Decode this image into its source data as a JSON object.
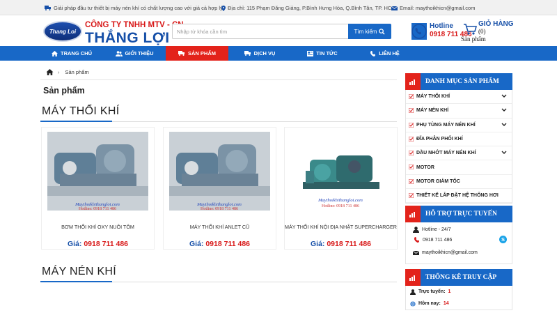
{
  "topbar": {
    "slogan": "Giải pháp đầu tư thiết bị máy nén khí có chất lượng cao với giá cả hợp lý",
    "address": "Địa chỉ: 115 Phạm Đăng Giảng, P.Bình Hưng Hòa, Q.Bình Tân, TP. HCM",
    "email": "Email: maythoikhicn@gmail.com"
  },
  "logo": {
    "badge": "Thang Loi",
    "company_line1": "CÔNG TY TNHH MTV - CN",
    "company_line2": "THẮNG LỢI"
  },
  "search": {
    "placeholder": "Nhập từ khóa cần tìm",
    "button": "Tìm kiếm"
  },
  "hotline": {
    "label": "Hotline",
    "number": "0918 711 486"
  },
  "cart": {
    "label": "GIỎ HÀNG",
    "count": "(0)",
    "unit": "Sản phẩm"
  },
  "nav": {
    "items": [
      {
        "label": "TRANG CHỦ",
        "icon": "home-icon"
      },
      {
        "label": "GIỚI THIỆU",
        "icon": "users-icon"
      },
      {
        "label": "SẢN PHẨM",
        "icon": "truck-icon",
        "active": true
      },
      {
        "label": "DỊCH VỤ",
        "icon": "truck-icon"
      },
      {
        "label": "TIN TỨC",
        "icon": "news-icon"
      },
      {
        "label": "LIÊN HỆ",
        "icon": "phone-icon"
      }
    ]
  },
  "breadcrumb": {
    "current": "Sản phẩm"
  },
  "page_title": "Sản phẩm",
  "sections": [
    {
      "title": "MÁY THỔI KHÍ",
      "products": [
        {
          "name": "BƠM THỔI KHÍ OXY NUÔI TÔM",
          "price_label": "Giá:",
          "price": "0918 711 486",
          "watermark": "Maythoikhithangloi.com\nHotline: 0918 711 486"
        },
        {
          "name": "MÁY THỔI KHÍ ANLET CŨ",
          "price_label": "Giá:",
          "price": "0918 711 486",
          "watermark": "Maythoikhithangloi.com\nHotline: 0918 711 486"
        },
        {
          "name": "MÁY THỔI KHÍ NỘI ĐỊA NHẬT SUPERCHARGER",
          "price_label": "Giá:",
          "price": "0918 711 486",
          "watermark": "Maythoikhithangloi.com\nHotline: 0918 711 486"
        }
      ]
    },
    {
      "title": "MÁY NÉN KHÍ",
      "products": []
    }
  ],
  "sidebar": {
    "categories_title": "DANH MỤC SẢN PHẨM",
    "categories": [
      {
        "label": "MÁY THỔI KHÍ",
        "has_children": true
      },
      {
        "label": "MÁY NÉN KHÍ",
        "has_children": true
      },
      {
        "label": "PHỤ TÙNG MÁY NÉN KHÍ",
        "has_children": true
      },
      {
        "label": "ĐĨA PHÂN PHỐI KHÍ",
        "has_children": false
      },
      {
        "label": "DẦU NHỚT MÁY NÉN KHÍ",
        "has_children": true
      },
      {
        "label": "MOTOR",
        "has_children": false
      },
      {
        "label": "MOTOR GIẢM TỐC",
        "has_children": false
      },
      {
        "label": "THIẾT KẾ LẮP ĐẶT HỆ THỐNG HƠI",
        "has_children": false
      }
    ],
    "support_title": "HỖ TRỢ TRỰC TUYẾN",
    "support": {
      "hotline_label": "Hotline - 24/7",
      "phone": "0918 711 486",
      "email": "maythoikhicn@gmail.com"
    },
    "stats_title": "THỐNG KÊ TRUY CẬP",
    "stats": [
      {
        "label": "Trực tuyến:",
        "value": "1"
      },
      {
        "label": "Hôm nay:",
        "value": "14"
      }
    ]
  },
  "colors": {
    "brand_blue": "#1868c7",
    "brand_red": "#e3231b",
    "price_red": "#d81818"
  }
}
